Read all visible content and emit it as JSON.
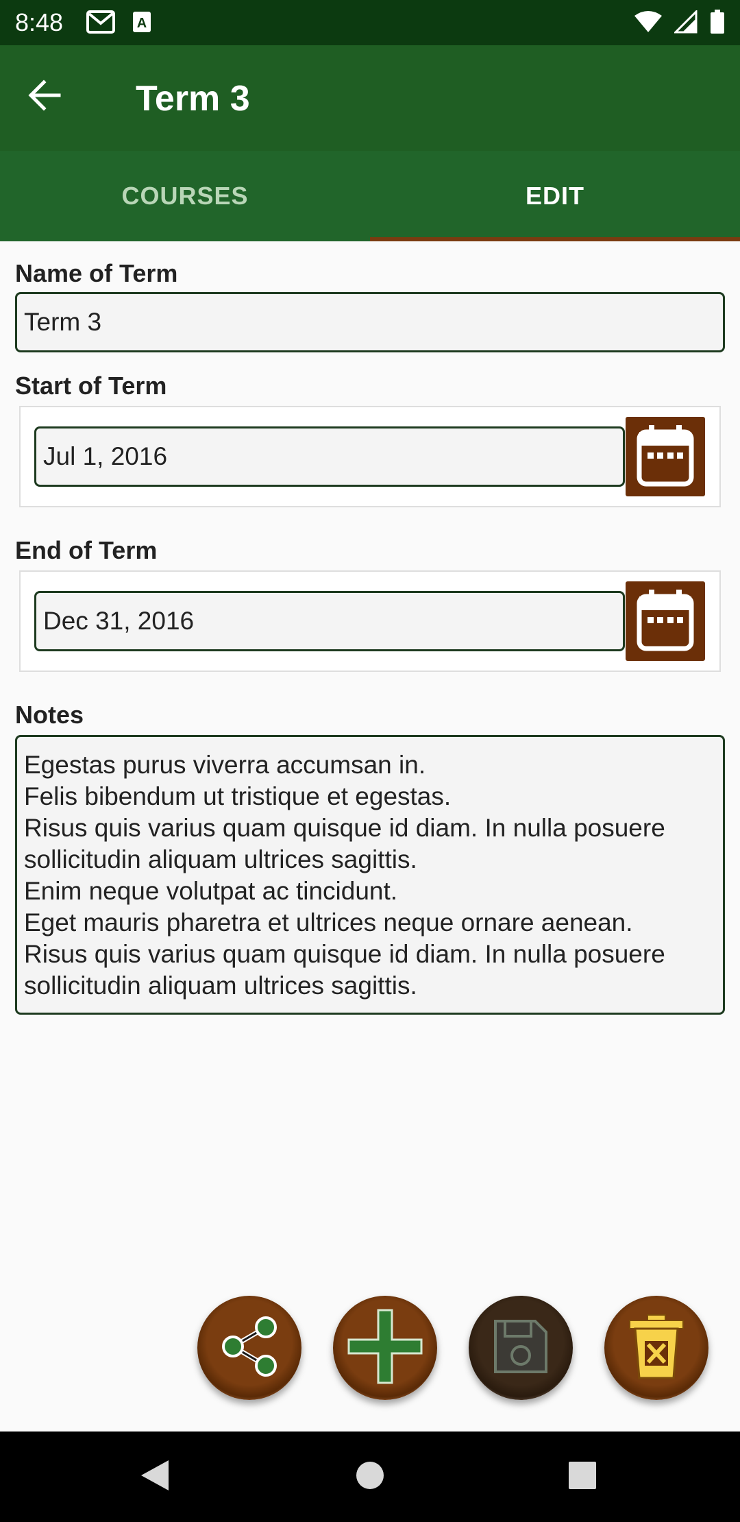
{
  "status_bar": {
    "time": "8:48",
    "left_icons": [
      "gmail-icon",
      "a-notification-icon"
    ],
    "right_icons": [
      "wifi-icon",
      "signal-icon",
      "battery-icon"
    ]
  },
  "app_bar": {
    "title": "Term 3",
    "back_icon": "arrow-back-icon"
  },
  "tabs": [
    {
      "label": "COURSES",
      "active": false
    },
    {
      "label": "EDIT",
      "active": true
    }
  ],
  "form": {
    "name_label": "Name of Term",
    "name_value": "Term 3",
    "start_label": "Start of Term",
    "start_value": "Jul 1, 2016",
    "end_label": "End of Term",
    "end_value": "Dec 31, 2016",
    "notes_label": "Notes",
    "notes_lines": [
      "Egestas purus viverra accumsan in.",
      "Felis bibendum ut tristique et egestas.",
      "Risus quis varius quam quisque id diam. In nulla posuere",
      "sollicitudin aliquam ultrices sagittis.",
      "Enim neque volutpat ac tincidunt.",
      "Eget mauris pharetra et ultrices neque ornare aenean.",
      "Risus quis varius quam quisque id diam. In nulla posuere",
      "sollicitudin aliquam ultrices sagittis."
    ]
  },
  "fabs": [
    "share-icon",
    "add-icon",
    "save-icon",
    "delete-icon"
  ],
  "nav_bar": [
    "back-triangle-icon",
    "home-circle-icon",
    "recents-square-icon"
  ],
  "colors": {
    "status_bar": "#0c3a10",
    "app_bar": "#1f5e23",
    "tabs": "#21652a",
    "tab_indicator": "#7a3b10",
    "accent_brown": "#6b2f08",
    "field_border": "#1d3a1f"
  }
}
